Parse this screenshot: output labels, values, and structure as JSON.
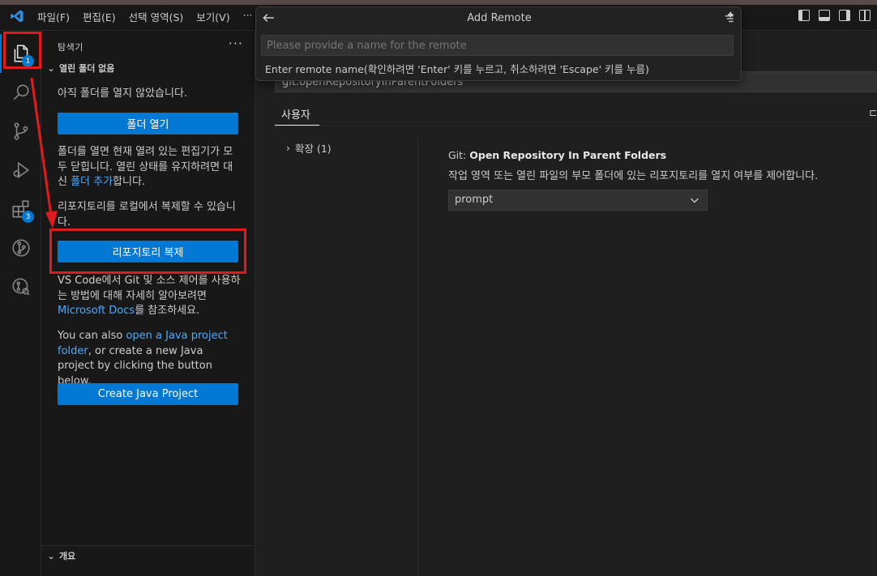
{
  "menu": [
    "파일(F)",
    "편집(E)",
    "선택 영역(S)",
    "보기(V)",
    "···"
  ],
  "activity": {
    "explorer_badge": "1",
    "extensions_badge": "3"
  },
  "sidebar": {
    "title": "탐색기",
    "more": "···",
    "section_open_folder": "열린 폴더 없음",
    "no_folder_text": "아직 폴더를 열지 않았습니다.",
    "open_folder_button": "폴더 열기",
    "close_editors_text_a": "폴더를 열면 현재 열려 있는 편집기가 모두 닫힙니다. 열린 상태를 유지하려면 대신 ",
    "close_editors_link": "폴더 추가",
    "close_editors_text_b": "합니다.",
    "clone_text": "리포지토리를 로컬에서 복제할 수 있습니다.",
    "clone_button": "리포지토리 복제",
    "git_text_a": "VS Code에서 Git 및 소스 제어를 사용하는 방법에 대해 자세히 알아보려면 ",
    "git_link": "Microsoft Docs",
    "git_text_b": "를 참조하세요.",
    "java_text_a": "You can also ",
    "java_link": "open a Java project folder",
    "java_text_b": ", or create a new Java project by clicking the button below.",
    "java_button": "Create Java Project",
    "section_outline": "개요"
  },
  "settings": {
    "search_value": "git.openRepositoryInParentFolders",
    "tab_user": "사용자",
    "tab_right": "⊏",
    "toc_item": "확장 (1)",
    "setting_category": "Git: ",
    "setting_name": "Open Repository In Parent Folders",
    "setting_desc": "작업 영역 또는 열린 파일의 부모 폴더에 있는 리포지토리를 열지 여부를 제어합니다.",
    "setting_value": "prompt"
  },
  "quick_input": {
    "title": "Add Remote",
    "placeholder": "Please provide a name for the remote",
    "message": "Enter remote name(확인하려면 'Enter' 키를 누르고, 취소하려면 'Escape' 키를 누름)"
  },
  "colors": {
    "accent": "#0078d4",
    "link": "#4daafc",
    "highlight": "#e11b1b"
  },
  "icons": [
    "vscode-logo-icon",
    "explorer-icon",
    "search-icon",
    "source-control-icon",
    "run-debug-icon",
    "extensions-icon",
    "git-graph-icon",
    "remote-explorer-icon",
    "back-arrow-icon",
    "chevron-down-icon"
  ]
}
